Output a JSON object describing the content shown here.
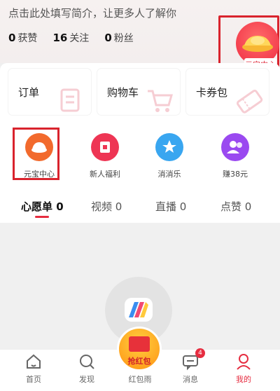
{
  "profile": {
    "bio": "点击此处填写简介，让更多人了解你",
    "stats": [
      {
        "value": "0",
        "label": "获赞"
      },
      {
        "value": "16",
        "label": "关注"
      },
      {
        "value": "0",
        "label": "粉丝"
      }
    ],
    "yuanbao_label": "元宝中心"
  },
  "tiles": [
    {
      "label": "订单",
      "icon": "order-icon"
    },
    {
      "label": "购物车",
      "icon": "cart-icon"
    },
    {
      "label": "卡券包",
      "icon": "coupon-icon"
    }
  ],
  "quick_icons": [
    {
      "label": "元宝中心",
      "icon": "ingot-icon",
      "color": "#f26a2d"
    },
    {
      "label": "新人福利",
      "icon": "gift-icon",
      "color": "#ee3554"
    },
    {
      "label": "消消乐",
      "icon": "star-wand-icon",
      "color": "#39a6f0"
    },
    {
      "label": "赚38元",
      "icon": "users-icon",
      "color": "#9a49f0"
    }
  ],
  "tabs": [
    {
      "label": "心愿单 0",
      "active": true
    },
    {
      "label": "视频 0"
    },
    {
      "label": "直播 0"
    },
    {
      "label": "点赞 0"
    }
  ],
  "bottom_nav": [
    {
      "label": "首页",
      "icon": "home-icon"
    },
    {
      "label": "发现",
      "icon": "search-icon"
    },
    {
      "label": "红包雨",
      "icon": "red-envelope-icon"
    },
    {
      "label": "消息",
      "icon": "message-icon",
      "badge": "4"
    },
    {
      "label": "我的",
      "icon": "profile-icon",
      "active": true
    }
  ],
  "hongbao": {
    "label": "抢红包"
  },
  "colors": {
    "accent": "#e62d40",
    "highlight_box": "#d9232d"
  }
}
